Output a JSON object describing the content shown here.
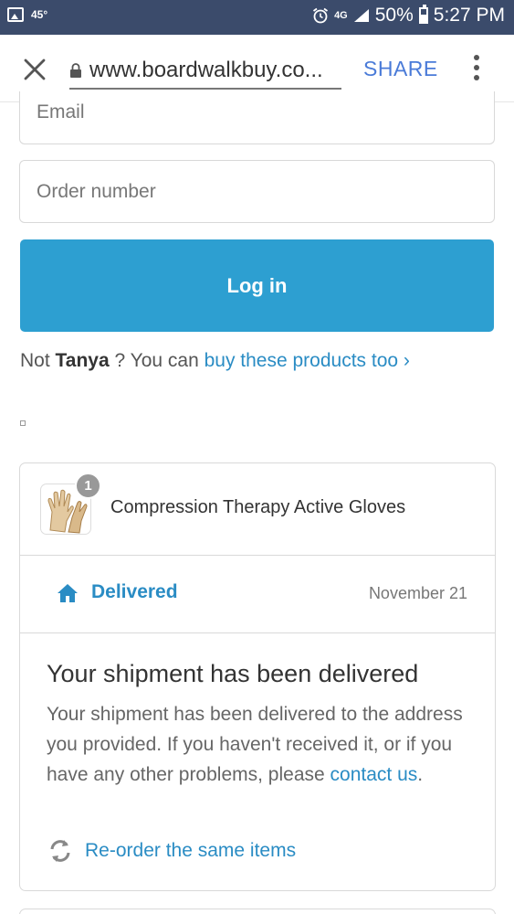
{
  "status_bar": {
    "temperature": "45°",
    "network": "4G",
    "battery": "50%",
    "time": "5:27 PM"
  },
  "browser": {
    "url": "www.boardwalkbuy.co...",
    "share_label": "SHARE"
  },
  "form": {
    "email_placeholder": "Email",
    "order_placeholder": "Order number",
    "login_label": "Log in",
    "not_prefix": "Not ",
    "user_name": "Tanya",
    "question": " ? You can ",
    "buy_link": "buy these products too ›"
  },
  "order": {
    "quantity": "1",
    "product_name": "Compression Therapy Active Gloves",
    "status": "Delivered",
    "date": "November 21",
    "shipment_title": "Your shipment has been delivered",
    "shipment_text": "Your shipment has been delivered to the address you provided. If you haven't received it, or if you have any other problems, please ",
    "contact_link": "contact us",
    "period": ".",
    "reorder_label": "Re-order the same items"
  },
  "colors": {
    "status_bar": "#3b4b6b",
    "accent": "#2d9fd1",
    "link": "#2a8cc4",
    "share": "#4a7bd8"
  }
}
